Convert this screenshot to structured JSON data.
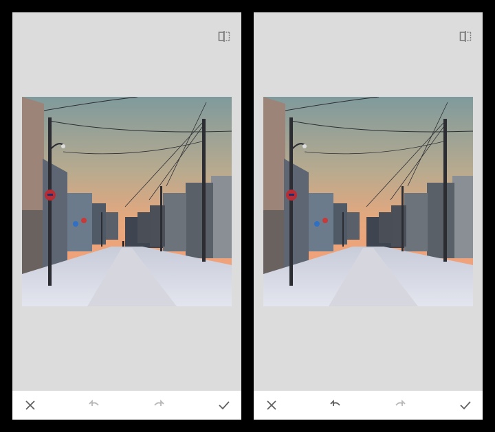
{
  "colors": {
    "canvas_background": "#dcdcdc",
    "toolbar_background": "#ffffff",
    "icon_active": "#5f5f5f",
    "icon_disabled": "#b8b8b8",
    "frame_background": "#000000"
  },
  "panels": [
    {
      "id": "before",
      "compare_icon": "compare-split-icon",
      "photo": "snowy-street-sunset",
      "shows_pedestrian": true,
      "toolbar": {
        "cancel_icon": "close-icon",
        "undo_icon": "undo-icon",
        "undo_enabled": false,
        "redo_icon": "redo-icon",
        "redo_enabled": false,
        "apply_icon": "checkmark-icon"
      }
    },
    {
      "id": "after",
      "compare_icon": "compare-split-icon",
      "photo": "snowy-street-sunset",
      "shows_pedestrian": false,
      "toolbar": {
        "cancel_icon": "close-icon",
        "undo_icon": "undo-icon",
        "undo_enabled": true,
        "redo_icon": "redo-icon",
        "redo_enabled": false,
        "apply_icon": "checkmark-icon"
      }
    }
  ]
}
